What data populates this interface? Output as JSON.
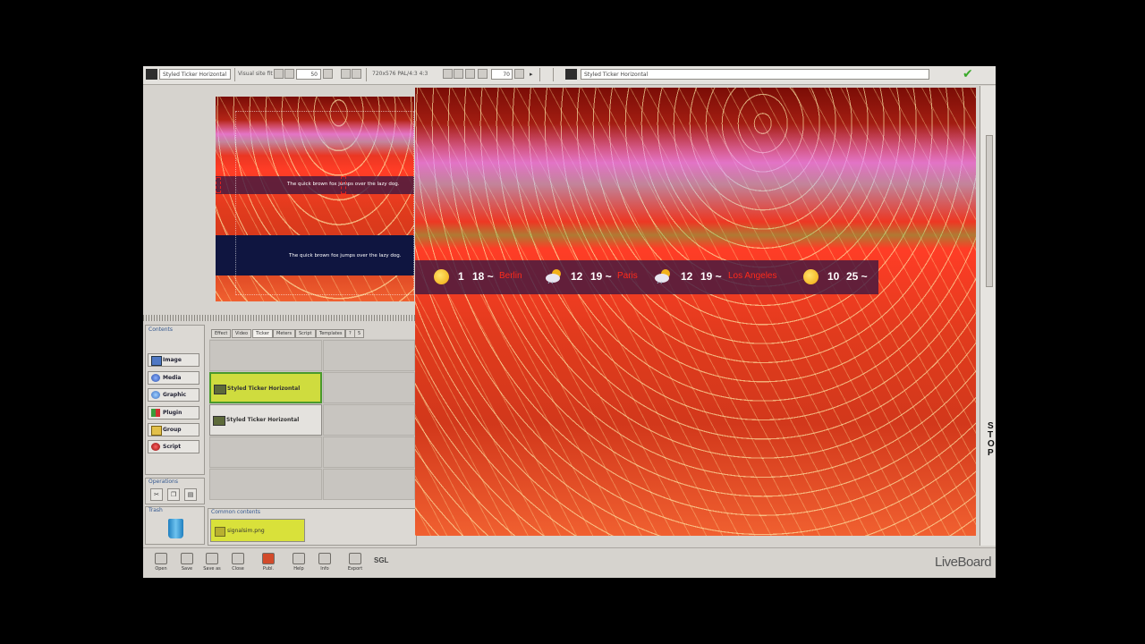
{
  "toolbar": {
    "layout_name": "Styled Ticker Horizontal",
    "visual_label": "Visual site fit",
    "zoom_value": "50",
    "resolution": "720x576 PAL/4:3 4:3",
    "zoom_percent": "70",
    "editor_title": "Styled Ticker Horizontal"
  },
  "preview": {
    "ticker_top_text": "The quick brown fox jumps over the lazy dog.",
    "ticker_bottom_text": "The quick brown fox jumps over the lazy dog."
  },
  "contents_panel": {
    "title": "Contents",
    "items": [
      {
        "label": "Image",
        "icon": "image-icon"
      },
      {
        "label": "Media",
        "icon": "media-icon"
      },
      {
        "label": "Graphic",
        "icon": "graphic-icon"
      },
      {
        "label": "Plugin",
        "icon": "plugin-icon"
      },
      {
        "label": "Group",
        "icon": "group-icon"
      },
      {
        "label": "Script",
        "icon": "script-icon"
      }
    ]
  },
  "operations_panel": {
    "title": "Operations"
  },
  "trash_panel": {
    "title": "Trash"
  },
  "tabs": [
    "Effect",
    "Video",
    "Ticker",
    "Meters",
    "Script",
    "Templates",
    "?",
    "5"
  ],
  "library_items": [
    {
      "label": "Styled Ticker Horizontal",
      "selected": true
    },
    {
      "label": "Styled Ticker Horizontal",
      "selected": false
    }
  ],
  "common_contents": {
    "title": "Common contents",
    "file": "signalsim.png"
  },
  "bottom_toolbar": [
    "Open",
    "Save",
    "Save as",
    "Close",
    "Publ.",
    "Help",
    "Info",
    "Export"
  ],
  "logos": {
    "sgl": "SGL",
    "liveboard": "LiveBoard"
  },
  "right_edge_letters": [
    "S",
    "T",
    "O",
    "P"
  ],
  "viewer_ticker": {
    "groups": [
      {
        "icon": "sun-icon",
        "low": "1",
        "high": "18 ~",
        "city": "Berlin"
      },
      {
        "icon": "cloud-icon",
        "low": "12",
        "high": "19 ~",
        "city": "Paris"
      },
      {
        "icon": "cloud-icon",
        "low": "12",
        "high": "19 ~",
        "city": "Los Angeles"
      },
      {
        "icon": "sun-icon",
        "low": "10",
        "high": "25 ~",
        "city": ""
      }
    ]
  },
  "colors": {
    "selection_green": "#c8dd3a",
    "ticker_bar": "#42183f",
    "ticker_red": "#ff2a1a",
    "panel_title_blue": "#33578f"
  }
}
